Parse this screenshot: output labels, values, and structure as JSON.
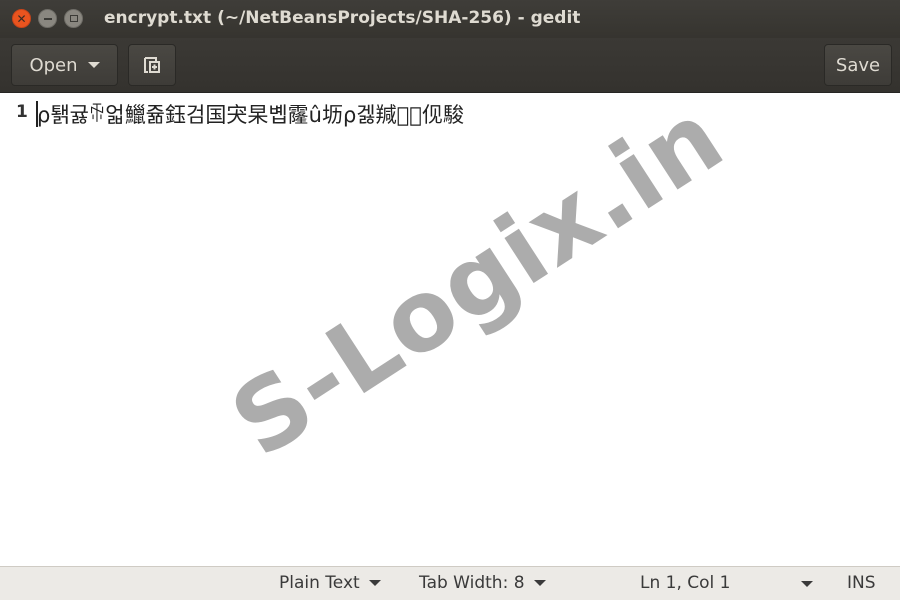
{
  "window": {
    "title": "encrypt.txt (~/NetBeansProjects/SHA-256) - gedit"
  },
  "toolbar": {
    "open_label": "Open",
    "save_label": "Save"
  },
  "editor": {
    "line_number": "1",
    "line_text": "ρ퇡귫ꏖ얿鱲쥶鈺검国宊杲볩霳û坜ρ겛羬巫ͤ伣駿"
  },
  "watermark": {
    "text": "S-Logix.in"
  },
  "statusbar": {
    "language": "Plain Text",
    "tab_width": "Tab Width: 8",
    "position": "Ln 1, Col 1",
    "mode": "INS"
  },
  "colors": {
    "titlebar_bg": "#3f3d39",
    "close_button": "#e9541f",
    "statusbar_bg": "#eceae6",
    "watermark": "#8c8c8c"
  }
}
